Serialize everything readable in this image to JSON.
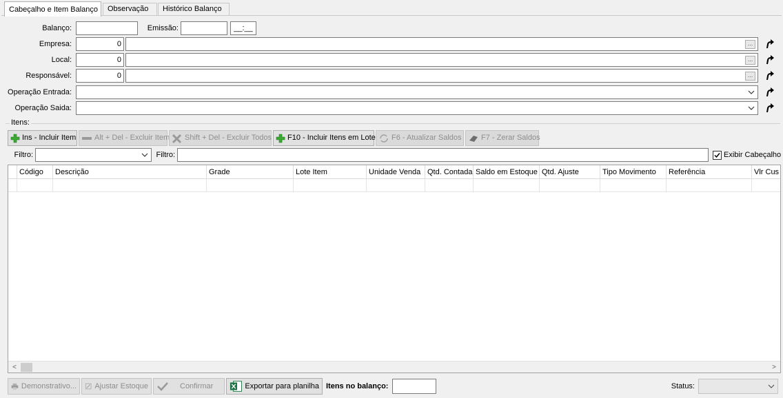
{
  "tabs": [
    {
      "label": "Cabeçalho e Item Balanço",
      "active": true
    },
    {
      "label": "Observação",
      "active": false
    },
    {
      "label": "Histórico Balanço",
      "active": false
    }
  ],
  "header": {
    "balanco_label": "Balanço:",
    "balanco_value": "",
    "emissao_label": "Emissão:",
    "emissao_value": "",
    "hora_value": "__:__",
    "empresa_label": "Empresa:",
    "empresa_code": "0",
    "empresa_name": "",
    "local_label": "Local:",
    "local_code": "0",
    "local_name": "",
    "responsavel_label": "Responsável:",
    "responsavel_code": "0",
    "responsavel_name": "",
    "op_entrada_label": "Operação Entrada:",
    "op_entrada_value": "",
    "op_saida_label": "Operação Saida:",
    "op_saida_value": "",
    "ellipsis": "..."
  },
  "itens": {
    "group_label": "Itens:",
    "toolbar": {
      "incluir": "Ins - Incluir Item",
      "excluir": "Alt + Del - Excluir Item",
      "excluir_todos": "Shift + Del - Excluir Todos",
      "incluir_lote": "F10 - Incluir Itens em Lote",
      "atualizar": "F6 - Atualizar Saldos",
      "zerar": "F7 - Zerar Saldos"
    },
    "filtro1_label": "Filtro:",
    "filtro1_value": "",
    "filtro2_label": "Filtro:",
    "filtro2_value": "",
    "exibir_cabecalho_label": "Exibir Cabeçalho",
    "exibir_cabecalho_checked": true,
    "columns": [
      "Código",
      "Descrição",
      "Grade",
      "Lote Item",
      "Unidade Venda",
      "Qtd. Contada",
      "Saldo em Estoque",
      "Qtd. Ajuste",
      "Tipo Movimento",
      "Referência",
      "Vlr Cus"
    ],
    "scroll_left": "<",
    "scroll_right": ">"
  },
  "footer": {
    "demonstrativo": "Demonstrativo...",
    "ajustar": "Ajustar Estoque",
    "confirmar": "Confirmar",
    "exportar": "Exportar para planilha",
    "itens_label": "Itens no balanço:",
    "itens_value": "",
    "status_label": "Status:",
    "status_value": ""
  },
  "colors": {
    "plus_green": "#3aa832",
    "excel_green": "#1e7145",
    "disabled_text": "#8d8d8d"
  }
}
